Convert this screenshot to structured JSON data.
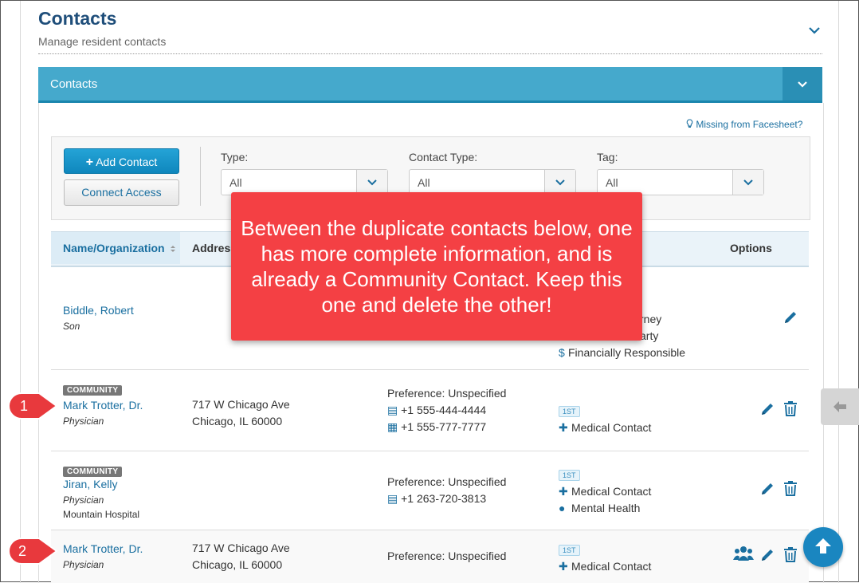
{
  "header": {
    "title": "Contacts",
    "subtitle": "Manage resident contacts"
  },
  "panel": {
    "title": "Contacts",
    "missing_link": "Missing from Facesheet?"
  },
  "actions": {
    "add_contact": "Add Contact",
    "connect_access": "Connect Access"
  },
  "filters": {
    "type_label": "Type:",
    "type_value": "All",
    "contact_type_label": "Contact Type:",
    "contact_type_value": "All",
    "tag_label": "Tag:",
    "tag_value": "All"
  },
  "table": {
    "col_name": "Name/Organization",
    "col_address": "Addres",
    "col_options": "Options",
    "rows": [
      {
        "name": "Biddle, Robert",
        "relation": "Son",
        "tags": [
          "rney",
          "arty",
          "Financially Responsible"
        ]
      },
      {
        "badge": "COMMUNITY",
        "name": "Mark Trotter, Dr.",
        "relation": "Physician",
        "address1": "717 W Chicago Ave",
        "address2": "Chicago, IL 60000",
        "preference": "Preference: Unspecified",
        "phone1": "+1 555-444-4444",
        "phone2": "+1 555-777-7777",
        "priority": "1ST",
        "tag": "Medical Contact"
      },
      {
        "badge": "COMMUNITY",
        "name": "Jiran, Kelly",
        "relation": "Physician",
        "org": "Mountain Hospital",
        "preference": "Preference: Unspecified",
        "phone1": "+1 263-720-3813",
        "priority": "1ST",
        "tag": "Medical Contact",
        "tag2": "Mental Health"
      },
      {
        "name": "Mark Trotter, Dr.",
        "relation": "Physician",
        "address1": "717 W Chicago Ave",
        "address2": "Chicago, IL 60000",
        "preference": "Preference: Unspecified",
        "priority": "1ST",
        "tag": "Medical Contact"
      }
    ]
  },
  "callout": {
    "text": "Between the duplicate contacts below, one has more complete information, and is already a Community Contact. Keep this one and delete the other!"
  },
  "markers": [
    "1",
    "2"
  ],
  "colors": {
    "header_bar": "#45a9cc",
    "link": "#1a6fa0",
    "callout": "#f44044",
    "primary_button": "#1a9ad1"
  }
}
